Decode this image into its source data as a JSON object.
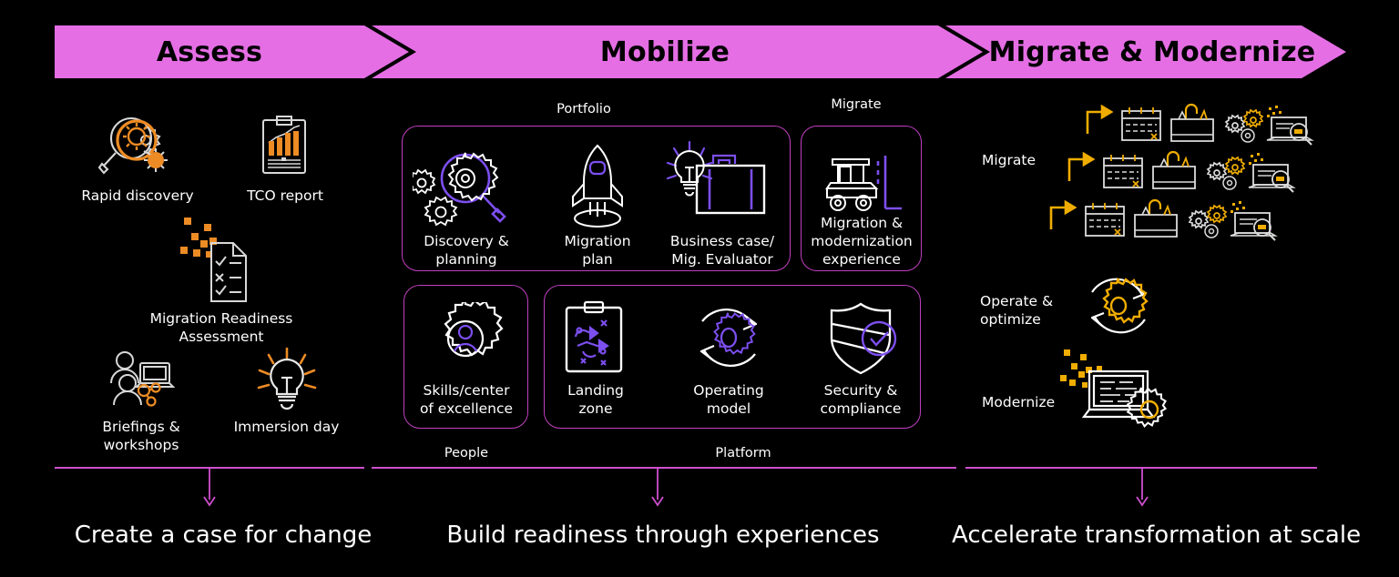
{
  "theme": {
    "background": "#000000",
    "banner_fill": "#e56ee5",
    "banner_text": "#000000",
    "accent_magenta": "#cf4fcf",
    "accent_purple": "#7d4ff0",
    "accent_orange": "#ed8b24",
    "accent_gold": "#f0ad00",
    "line_white": "#ffffff"
  },
  "banner": {
    "phases": [
      {
        "id": "assess",
        "label": "Assess"
      },
      {
        "id": "mobilize",
        "label": "Mobilize"
      },
      {
        "id": "migrate",
        "label": "Migrate & Modernize"
      }
    ]
  },
  "assess": {
    "items": [
      {
        "id": "rapid-discovery",
        "icon": "magnifier-gears-icon",
        "label": "Rapid discovery"
      },
      {
        "id": "tco-report",
        "icon": "clipboard-barchart-icon",
        "label": "TCO report"
      },
      {
        "id": "mra",
        "icon": "checklist-document-icon",
        "label": "Migration Readiness\nAssessment"
      },
      {
        "id": "briefings",
        "icon": "people-laptop-icon",
        "label": "Briefings &\nworkshops"
      },
      {
        "id": "immersion-day",
        "icon": "lightbulb-icon",
        "label": "Immersion day"
      }
    ]
  },
  "mobilize": {
    "groups": [
      {
        "id": "portfolio",
        "label": "Portfolio",
        "position": "top"
      },
      {
        "id": "migrate",
        "label": "Migrate",
        "position": "top"
      },
      {
        "id": "people",
        "label": "People",
        "position": "bottom"
      },
      {
        "id": "platform",
        "label": "Platform",
        "position": "bottom"
      }
    ],
    "portfolio_items": [
      {
        "id": "discovery-planning",
        "icon": "gears-magnifier-icon",
        "label": "Discovery &\nplanning"
      },
      {
        "id": "migration-plan",
        "icon": "rocket-icon",
        "label": "Migration\nplan"
      },
      {
        "id": "business-case",
        "icon": "bulb-briefcase-icon",
        "label": "Business case/\nMig. Evaluator"
      }
    ],
    "migrate_items": [
      {
        "id": "migration-experience",
        "icon": "forklift-icon",
        "label": "Migration &\nmodernization\nexperience"
      }
    ],
    "people_items": [
      {
        "id": "skills-coe",
        "icon": "gear-person-icon",
        "label": "Skills/center\nof excellence"
      }
    ],
    "platform_items": [
      {
        "id": "landing-zone",
        "icon": "clipboard-network-icon",
        "label": "Landing\nzone"
      },
      {
        "id": "operating-model",
        "icon": "gear-cycle-icon",
        "label": "Operating\nmodel"
      },
      {
        "id": "security",
        "icon": "shield-check-icon",
        "label": "Security &\ncompliance"
      }
    ]
  },
  "migrate_modernize": {
    "rows": [
      {
        "id": "migrate",
        "label": "Migrate"
      },
      {
        "id": "operate-optimize",
        "label": "Operate &\noptimize"
      },
      {
        "id": "modernize",
        "label": "Modernize"
      }
    ],
    "migrate_wave_icons": [
      "arrow-right-icon",
      "calendar-icon",
      "toolbox-icon",
      "gears-icon",
      "laptop-search-icon"
    ],
    "migrate_wave_count": 3,
    "operate_icon": "gear-refresh-cycle-icon",
    "modernize_icon": "laptop-code-gear-icon"
  },
  "footer": {
    "captions": [
      {
        "id": "assess-outcome",
        "label": "Create a case for change"
      },
      {
        "id": "mobilize-outcome",
        "label": "Build readiness through experiences"
      },
      {
        "id": "migrate-outcome",
        "label": "Accelerate transformation at scale"
      }
    ]
  }
}
